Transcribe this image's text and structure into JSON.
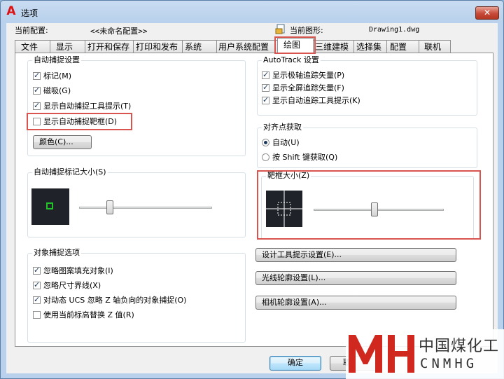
{
  "window": {
    "title": "选项",
    "close_label": "✕"
  },
  "header": {
    "current_profile_label": "当前配置:",
    "current_profile_value": "<<未命名配置>>",
    "current_drawing_label": "当前图形:",
    "current_drawing_value": "Drawing1.dwg"
  },
  "tabs": [
    {
      "label": "文件"
    },
    {
      "label": "显示"
    },
    {
      "label": "打开和保存"
    },
    {
      "label": "打印和发布"
    },
    {
      "label": "系统"
    },
    {
      "label": "用户系统配置"
    },
    {
      "label": "绘图"
    },
    {
      "label": "三维建模"
    },
    {
      "label": "选择集"
    },
    {
      "label": "配置"
    },
    {
      "label": "联机"
    }
  ],
  "active_tab": "绘图",
  "autosnap": {
    "title": "自动捕捉设置",
    "options": [
      {
        "label": "标记(M)",
        "checked": true
      },
      {
        "label": "磁吸(G)",
        "checked": true
      },
      {
        "label": "显示自动捕捉工具提示(T)",
        "checked": true
      },
      {
        "label": "显示自动捕捉靶框(D)",
        "checked": false
      }
    ],
    "color_button": "颜色(C)..."
  },
  "marker_size": {
    "title": "自动捕捉标记大小(S)",
    "slider_fraction": 0.23,
    "marker_color": "#22c22a"
  },
  "object_snap": {
    "title": "对象捕捉选项",
    "options": [
      {
        "label": "忽略图案填充对象(I)",
        "checked": true
      },
      {
        "label": "忽略尺寸界线(X)",
        "checked": true
      },
      {
        "label": "对动态 UCS 忽略 Z 轴负向的对象捕捉(O)",
        "checked": true
      },
      {
        "label": "使用当前标高替换 Z 值(R)",
        "checked": false
      }
    ]
  },
  "autotrack": {
    "title": "AutoTrack 设置",
    "options": [
      {
        "label": "显示极轴追踪矢量(P)",
        "checked": true
      },
      {
        "label": "显示全屏追踪矢量(F)",
        "checked": true
      },
      {
        "label": "显示自动追踪工具提示(K)",
        "checked": true
      }
    ]
  },
  "alignment": {
    "title": "对齐点获取",
    "options": [
      {
        "label": "自动(U)",
        "selected": true
      },
      {
        "label": "按 Shift 键获取(Q)",
        "selected": false
      }
    ]
  },
  "aperture_size": {
    "title": "靶框大小(Z)",
    "slider_fraction": 0.47
  },
  "right_buttons": {
    "design_tooltip": "设计工具提示设置(E)...",
    "lightglyph": "光线轮廓设置(L)...",
    "cameraglyph": "相机轮廓设置(A)..."
  },
  "footer": {
    "ok": "确定",
    "cancel": "取"
  },
  "watermark": {
    "cn": "中国煤化工",
    "en": "CNMHG",
    "color": "#d0281f"
  }
}
